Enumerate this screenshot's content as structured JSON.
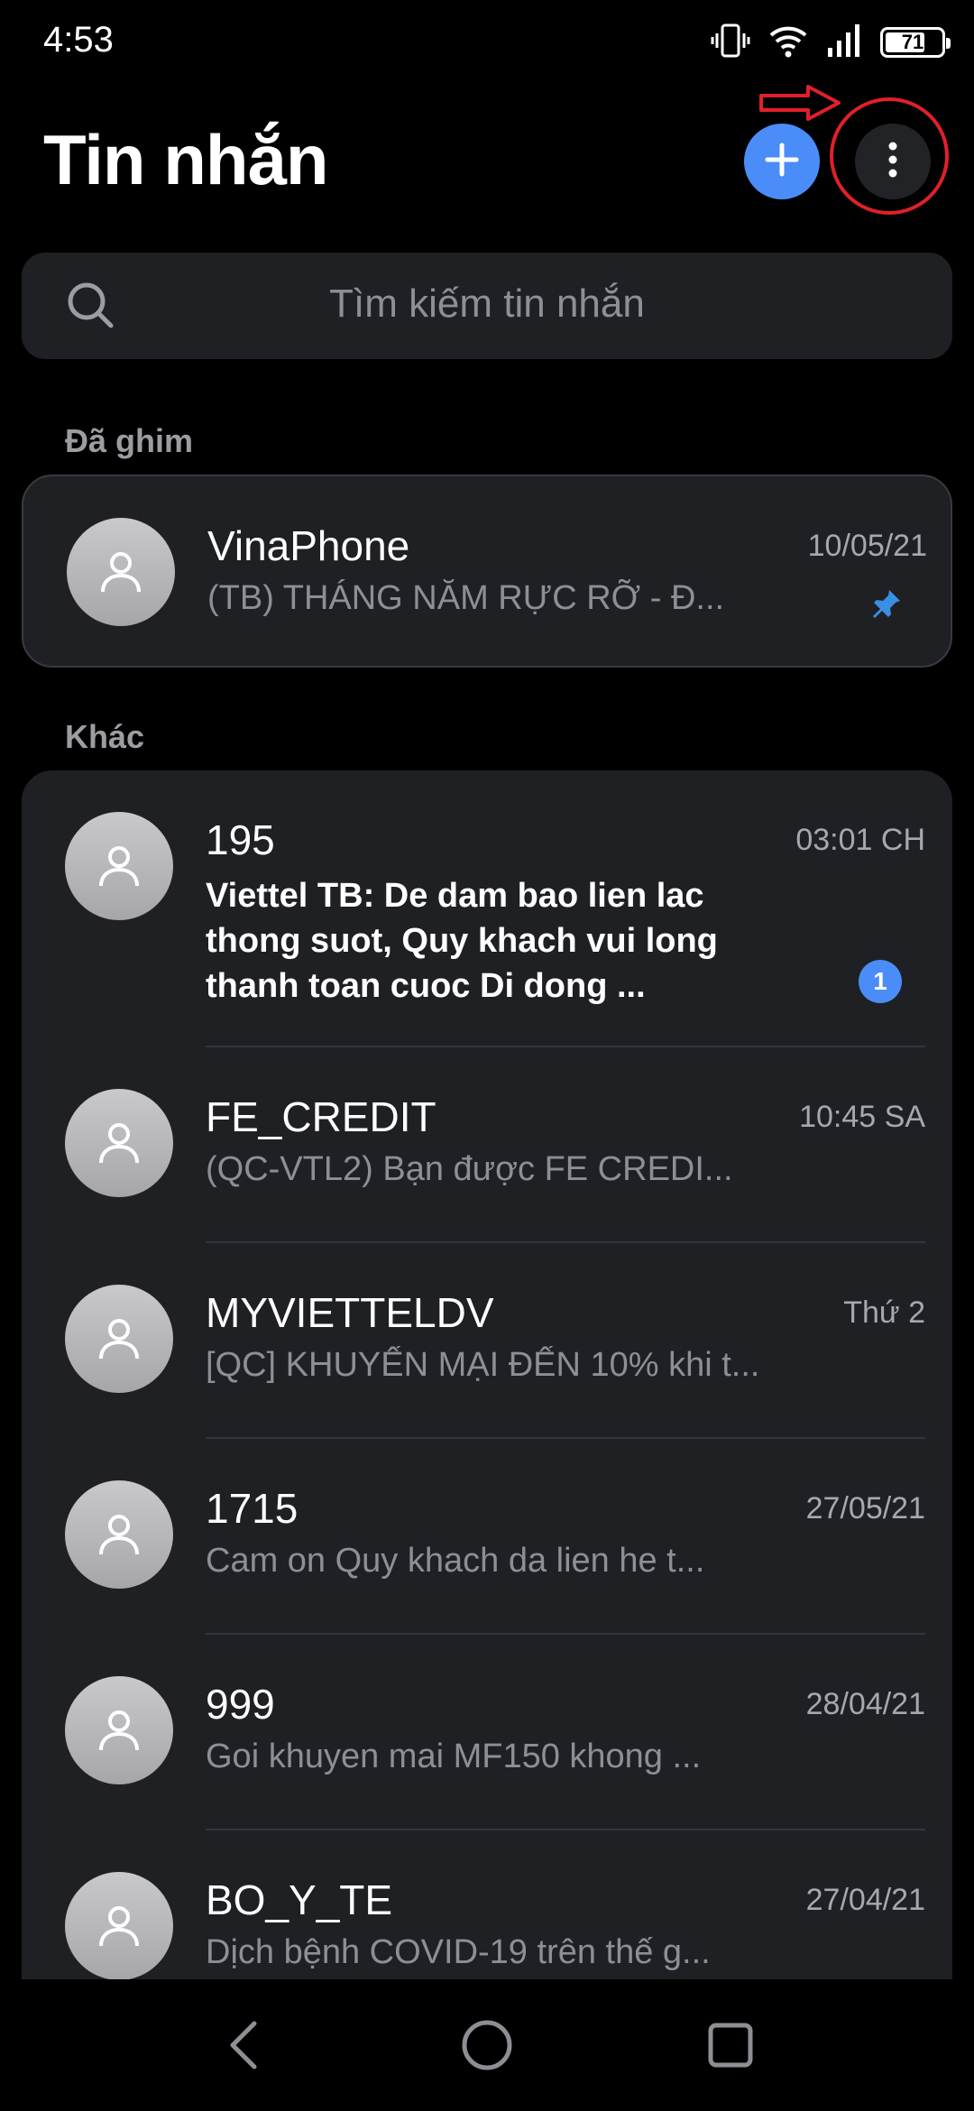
{
  "status_bar": {
    "time": "4:53",
    "battery_level": "71",
    "battery_fraction": 0.71
  },
  "header": {
    "title": "Tin nhắn"
  },
  "search": {
    "placeholder": "Tìm kiếm tin nhắn"
  },
  "sections": {
    "pinned_label": "Đã ghim",
    "others_label": "Khác"
  },
  "pinned": [
    {
      "name": "VinaPhone",
      "time": "10/05/21",
      "preview": "(TB) THÁNG NĂM RỰC RỠ - Đ..."
    }
  ],
  "conversations": [
    {
      "name": "195",
      "time": "03:01 CH",
      "preview": "Viettel TB: De dam bao lien lac thong suot, Quy khach vui long thanh toan cuoc Di dong ...",
      "unread": "1"
    },
    {
      "name": "FE_CREDIT",
      "time": "10:45 SA",
      "preview": "(QC-VTL2) Bạn được FE CREDI..."
    },
    {
      "name": "MYVIETTELDV",
      "time": "Thứ 2",
      "preview": "[QC] KHUYẾN MẠI ĐẾN 10% khi t..."
    },
    {
      "name": "1715",
      "time": "27/05/21",
      "preview": "Cam on Quy khach da lien he t..."
    },
    {
      "name": "999",
      "time": "28/04/21",
      "preview": "Goi khuyen mai MF150 khong ..."
    },
    {
      "name": "BO_Y_TE",
      "time": "27/04/21",
      "preview": "Dịch bệnh COVID-19 trên thế g..."
    }
  ],
  "icons": {
    "compose": "plus-icon",
    "more": "more-vertical-icon",
    "search": "search-icon",
    "avatar": "person-icon",
    "pin": "pin-icon",
    "nav_back": "back-icon",
    "nav_home": "home-icon",
    "nav_recents": "recents-icon"
  },
  "colors": {
    "accent": "#4a8df8",
    "annotation": "#e1202a",
    "card": "#1f2024"
  }
}
